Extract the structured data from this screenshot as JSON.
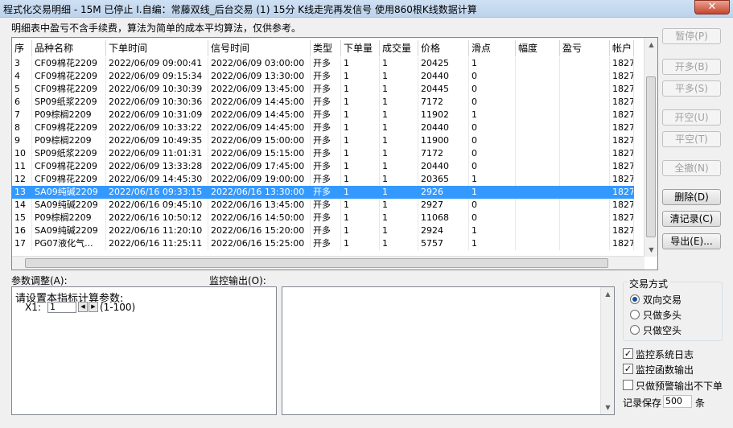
{
  "window": {
    "title": "程式化交易明细 - 15M 已停止  I.自编：常藤双线_后台交易 (1) 15分 K线走完再发信号 使用860根K线数据计算",
    "close": "✕"
  },
  "note": "明细表中盈亏不含手续费，算法为简单的成本平均算法，仅供参考。",
  "table": {
    "columns": [
      "序",
      "品种名称",
      "下单时间",
      "信号时间",
      "类型",
      "下单量",
      "成交量",
      "价格",
      "滑点",
      "幅度",
      "盈亏",
      "帐户"
    ],
    "rows": [
      [
        "3",
        "CF09棉花2209",
        "2022/06/09  09:00:41",
        "2022/06/09  03:00:00",
        "开多",
        "1",
        "1",
        "20425",
        "1",
        "",
        "",
        "1827"
      ],
      [
        "4",
        "CF09棉花2209",
        "2022/06/09  09:15:34",
        "2022/06/09  13:30:00",
        "开多",
        "1",
        "1",
        "20440",
        "0",
        "",
        "",
        "1827"
      ],
      [
        "5",
        "CF09棉花2209",
        "2022/06/09  10:30:39",
        "2022/06/09  13:45:00",
        "开多",
        "1",
        "1",
        "20445",
        "0",
        "",
        "",
        "1827"
      ],
      [
        "6",
        "SP09纸浆2209",
        "2022/06/09  10:30:36",
        "2022/06/09  14:45:00",
        "开多",
        "1",
        "1",
        "7172",
        "0",
        "",
        "",
        "1827"
      ],
      [
        "7",
        "P09棕榈2209",
        "2022/06/09  10:31:09",
        "2022/06/09  14:45:00",
        "开多",
        "1",
        "1",
        "11902",
        "1",
        "",
        "",
        "1827"
      ],
      [
        "8",
        "CF09棉花2209",
        "2022/06/09  10:33:22",
        "2022/06/09  14:45:00",
        "开多",
        "1",
        "1",
        "20440",
        "0",
        "",
        "",
        "1827"
      ],
      [
        "9",
        "P09棕榈2209",
        "2022/06/09  10:49:35",
        "2022/06/09  15:00:00",
        "开多",
        "1",
        "1",
        "11900",
        "0",
        "",
        "",
        "1827"
      ],
      [
        "10",
        "SP09纸浆2209",
        "2022/06/09  11:01:31",
        "2022/06/09  15:15:00",
        "开多",
        "1",
        "1",
        "7172",
        "0",
        "",
        "",
        "1827"
      ],
      [
        "11",
        "CF09棉花2209",
        "2022/06/09  13:33:28",
        "2022/06/09  17:45:00",
        "开多",
        "1",
        "1",
        "20440",
        "0",
        "",
        "",
        "1827"
      ],
      [
        "12",
        "CF09棉花2209",
        "2022/06/09  14:45:30",
        "2022/06/09  19:00:00",
        "开多",
        "1",
        "1",
        "20365",
        "1",
        "",
        "",
        "1827"
      ],
      [
        "13",
        "SA09纯碱2209",
        "2022/06/16  09:33:15",
        "2022/06/16  13:30:00",
        "开多",
        "1",
        "1",
        "2926",
        "1",
        "",
        "",
        "1827"
      ],
      [
        "14",
        "SA09纯碱2209",
        "2022/06/16  09:45:10",
        "2022/06/16  13:45:00",
        "开多",
        "1",
        "1",
        "2927",
        "0",
        "",
        "",
        "1827"
      ],
      [
        "15",
        "P09棕榈2209",
        "2022/06/16  10:50:12",
        "2022/06/16  14:50:00",
        "开多",
        "1",
        "1",
        "11068",
        "0",
        "",
        "",
        "1827"
      ],
      [
        "16",
        "SA09纯碱2209",
        "2022/06/16  11:20:10",
        "2022/06/16  15:20:00",
        "开多",
        "1",
        "1",
        "2924",
        "1",
        "",
        "",
        "1827"
      ],
      [
        "17",
        "PG07液化气...",
        "2022/06/16  11:25:11",
        "2022/06/16  15:25:00",
        "开多",
        "1",
        "1",
        "5757",
        "1",
        "",
        "",
        "1827"
      ]
    ],
    "selected_row": 10
  },
  "buttons": {
    "pause": "暂停(P)",
    "open_long": "开多(B)",
    "close_long": "平多(S)",
    "open_short": "开空(U)",
    "close_short": "平空(T)",
    "cancel_all": "全撤(N)",
    "delete": "删除(D)",
    "clear": "清记录(C)",
    "export": "导出(E)..."
  },
  "params": {
    "label": "参数调整(A):",
    "heading": "请设置本指标计算参数:",
    "x1_label": "X1:",
    "x1_value": "1",
    "x1_range": "(1-100)"
  },
  "output": {
    "label": "监控输出(O):"
  },
  "trade_mode": {
    "label": "交易方式",
    "options": [
      "双向交易",
      "只做多头",
      "只做空头"
    ],
    "selected": 0
  },
  "checks": [
    {
      "label": "监控系统日志",
      "checked": true
    },
    {
      "label": "监控函数输出",
      "checked": true
    },
    {
      "label": "只做预警输出不下单",
      "checked": false
    }
  ],
  "record": {
    "label": "记录保存",
    "value": "500",
    "unit": "条"
  },
  "colors": {
    "selection": "#3399ff",
    "title_bar": "#bcd3ec",
    "close": "#c7452d"
  }
}
